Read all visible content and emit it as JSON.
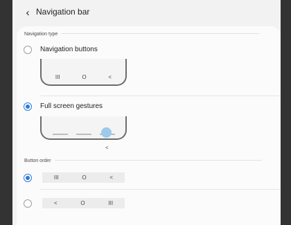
{
  "header": {
    "back_icon": "chevron-left-icon",
    "back_glyph": "‹",
    "title": "Navigation bar"
  },
  "navigation_type": {
    "label": "Navigation type",
    "options": [
      {
        "label": "Navigation buttons",
        "selected": false,
        "preview_buttons": [
          "III",
          "O",
          "<"
        ]
      },
      {
        "label": "Full screen gestures",
        "selected": true,
        "hint_glyph": "<"
      }
    ]
  },
  "button_order": {
    "label": "Button order",
    "options": [
      {
        "selected": true,
        "buttons": [
          "III",
          "O",
          "<"
        ]
      },
      {
        "selected": false,
        "buttons": [
          "<",
          "O",
          "III"
        ]
      }
    ]
  },
  "colors": {
    "accent": "#2a78d8",
    "gesture_dot": "#9ccaea"
  }
}
